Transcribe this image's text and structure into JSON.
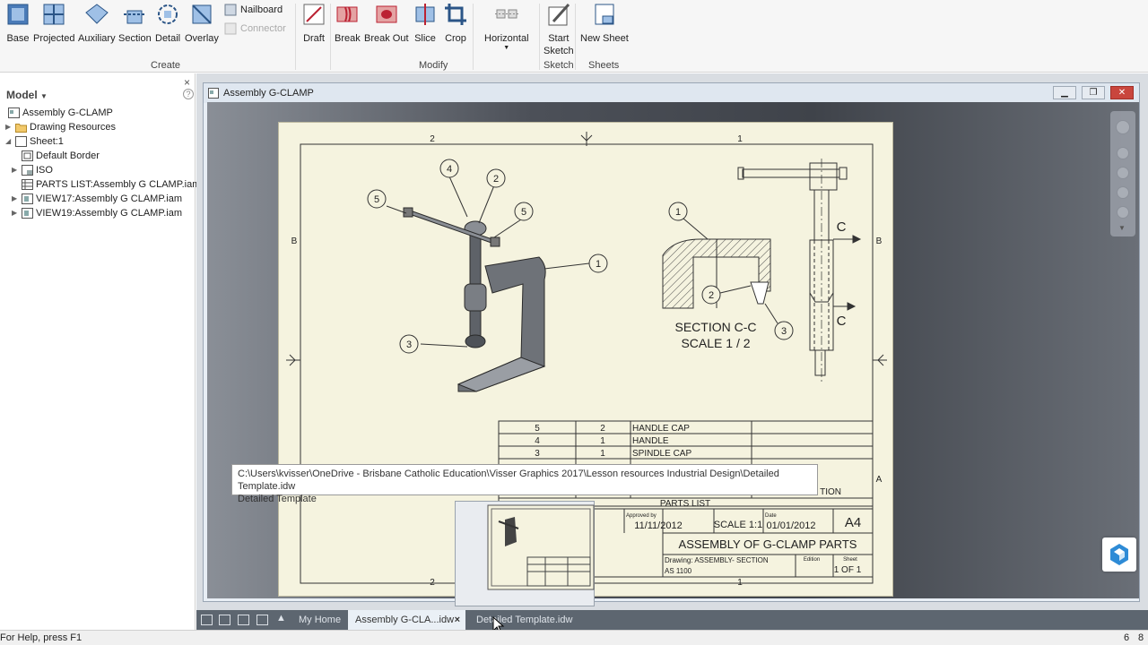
{
  "ribbon": {
    "create_buttons": [
      "Base",
      "Projected",
      "Auxiliary",
      "Section",
      "Detail",
      "Overlay"
    ],
    "nailboard": "Nailboard",
    "connector": "Connector",
    "draft": "Draft",
    "modify_buttons": [
      "Break",
      "Break Out",
      "Slice",
      "Crop"
    ],
    "horizontal": "Horizontal",
    "start_sketch": [
      "Start",
      "Sketch"
    ],
    "new_sheet": "New Sheet",
    "groups": {
      "create": "Create",
      "modify": "Modify",
      "sketch": "Sketch",
      "sheets": "Sheets"
    }
  },
  "model_panel": {
    "title": "Model",
    "help": "?",
    "close": "×",
    "tree": [
      {
        "label": "Assembly G-CLAMP"
      },
      {
        "label": "Drawing Resources"
      },
      {
        "label": "Sheet:1"
      },
      {
        "label": "Default Border"
      },
      {
        "label": "ISO"
      },
      {
        "label": "PARTS LIST:Assembly G CLAMP.iam"
      },
      {
        "label": "VIEW17:Assembly G CLAMP.iam"
      },
      {
        "label": "VIEW19:Assembly G CLAMP.iam"
      }
    ]
  },
  "document": {
    "title": "Assembly G-CLAMP"
  },
  "drawing": {
    "zones_top": [
      "2",
      "1"
    ],
    "zones_side": [
      "B",
      "A"
    ],
    "balloons": [
      "4",
      "2",
      "5",
      "5",
      "1",
      "3",
      "1",
      "2",
      "3"
    ],
    "section_label": "SECTION C-C",
    "section_scale": "SCALE 1 / 2",
    "cut_letters": [
      "C",
      "C"
    ],
    "parts_rows": [
      {
        "item": "5",
        "qty": "2",
        "name": "HANDLE CAP"
      },
      {
        "item": "4",
        "qty": "1",
        "name": "HANDLE"
      },
      {
        "item": "3",
        "qty": "1",
        "name": "SPINDLE CAP"
      }
    ],
    "partial_text": "TION",
    "parts_list_title": "PARTS LIST",
    "title_block": {
      "approved_by_label": "Approved by",
      "approved_date": "11/11/2012",
      "scale": "SCALE 1:1",
      "date_label": "Date",
      "date": "01/01/2012",
      "size": "A4",
      "title": "ASSEMBLY OF G-CLAMP PARTS",
      "drawing_label": "Drawing: ASSEMBLY- SECTION",
      "edition_label": "Edition",
      "sheet_label": "Sheet",
      "drawing_no": "AS 1100",
      "sheet": "1 OF 1"
    }
  },
  "tooltip": {
    "path": "C:\\Users\\kvisser\\OneDrive - Brisbane Catholic Education\\Visser Graphics 2017\\Lesson resources Industrial Design\\Detailed Template.idw",
    "name": "Detailed Template"
  },
  "tabs": {
    "my_home": "My Home",
    "active": "Assembly G-CLA...idw",
    "close": "×",
    "other": "Detailed Template.idw"
  },
  "status": {
    "help": "For Help, press F1",
    "left": "6",
    "right": "8"
  }
}
